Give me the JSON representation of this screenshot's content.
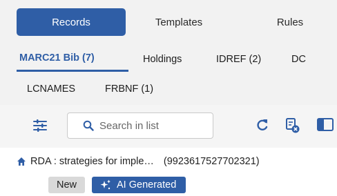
{
  "top_tabs": [
    {
      "label": "Records",
      "active": true
    },
    {
      "label": "Templates",
      "active": false
    },
    {
      "label": "Rules",
      "active": false
    }
  ],
  "sub_tabs": [
    {
      "label": "MARC21 Bib (7)",
      "active": true
    },
    {
      "label": "Holdings",
      "active": false
    },
    {
      "label": "IDREF (2)",
      "active": false
    },
    {
      "label": "DC",
      "active": false
    },
    {
      "label": "LCNAMES",
      "active": false
    },
    {
      "label": "FRBNF (1)",
      "active": false
    }
  ],
  "toolbar": {
    "search_placeholder": "Search in list",
    "icons": [
      "filter-icon",
      "search-icon",
      "refresh-icon",
      "clear-filter-icon",
      "panel-toggle-icon"
    ]
  },
  "record": {
    "icon": "home-icon",
    "title": "RDA : strategies for imple…",
    "id": "(9923617527702321)",
    "badges": {
      "new": "New",
      "ai": "AI Generated"
    }
  },
  "colors": {
    "accent": "#2f5ea6",
    "tab_bg": "#f2f2f2",
    "badge_new_bg": "#d9d9d9"
  }
}
